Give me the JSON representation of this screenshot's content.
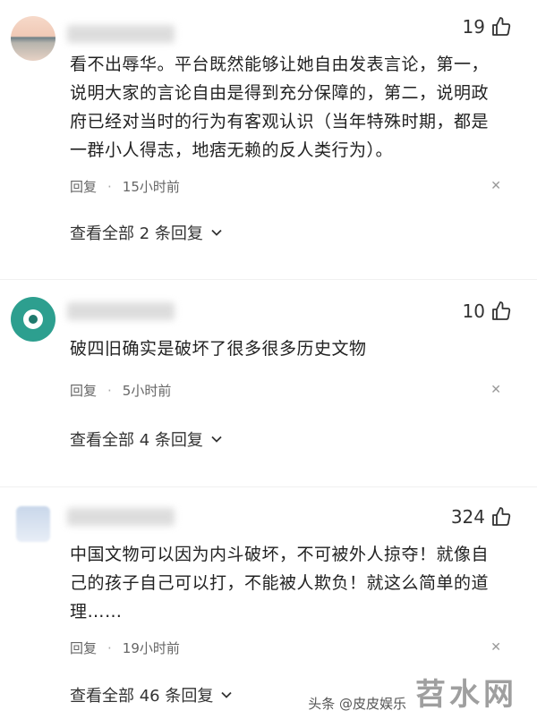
{
  "comments": [
    {
      "likes": "19",
      "text": "看不出辱华。平台既然能够让她自由发表言论，第一，说明大家的言论自由是得到充分保障的，第二，说明政府已经对当时的行为有客观认识（当年特殊时期，都是一群小人得志，地痞无赖的反人类行为）。",
      "reply_label": "回复",
      "time": "15小时前",
      "view_replies": "查看全部 2 条回复"
    },
    {
      "likes": "10",
      "text": "破四旧确实是破坏了很多很多历史文物",
      "reply_label": "回复",
      "time": "5小时前",
      "view_replies": "查看全部 4 条回复"
    },
    {
      "likes": "324",
      "text": "中国文物可以因为内斗破坏，不可被外人掠夺！就像自己的孩子自己可以打，不能被人欺负！就这么简单的道理……",
      "reply_label": "回复",
      "time": "19小时前",
      "view_replies": "查看全部 46 条回复"
    }
  ],
  "watermark": {
    "site": "苕水网",
    "account": "头条 @皮皮娱乐"
  },
  "icons": {
    "like": "thumbs-up-icon",
    "close": "close-icon",
    "expand": "chevron-down-icon"
  }
}
